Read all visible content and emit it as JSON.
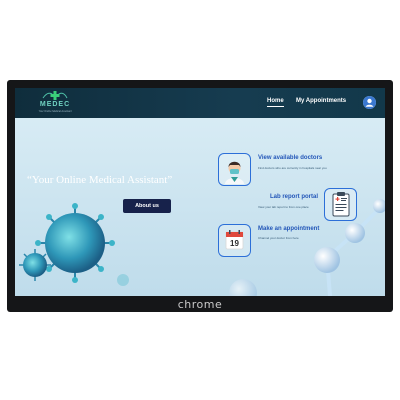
{
  "app": {
    "brand": "MEDEC",
    "tagline": "Your Online Medical Assistant"
  },
  "nav": {
    "home": "Home",
    "appointments": "My Appointments"
  },
  "hero": {
    "quote": "“Your Online Medical Assistant”",
    "about_button": "About us"
  },
  "features": [
    {
      "title": "View available doctors",
      "subtitle": "Find doctors who are currently in hospitals near you",
      "icon": "doctor-icon"
    },
    {
      "title": "Lab report portal",
      "subtitle": "View your lab report to from one place",
      "icon": "clipboard-report-icon"
    },
    {
      "title": "Make an appointment",
      "subtitle": "Channel your doctor from here",
      "icon": "calendar-icon"
    }
  ],
  "calendar_day": "19",
  "device": {
    "label": "chrome"
  },
  "colors": {
    "nav_bg": "#163c50",
    "accent": "#2356b8",
    "button_bg": "#17224b",
    "bezel": "#151618"
  }
}
